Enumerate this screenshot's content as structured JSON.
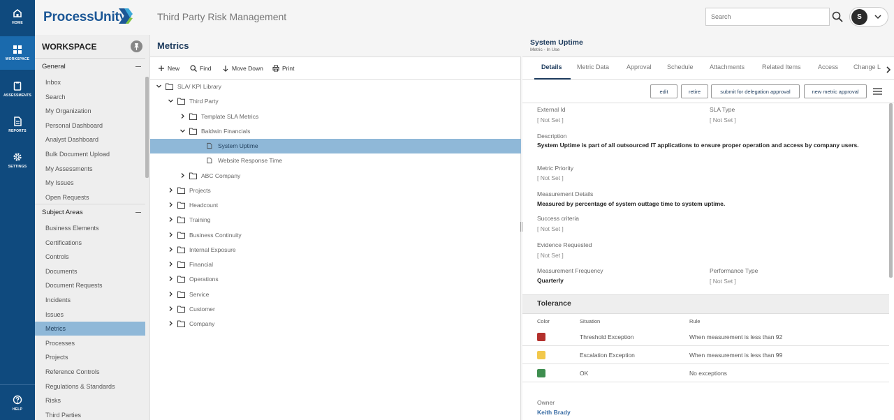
{
  "rail": {
    "home": "HOME",
    "workspace": "WORKSPACE",
    "assessments": "ASSESSMENTS",
    "reports": "REPORTS",
    "settings": "SETTINGS",
    "help": "HELP"
  },
  "header": {
    "logo": "ProcessUnity",
    "app_title": "Third Party Risk Management",
    "search_placeholder": "Search",
    "avatar_initial": "S"
  },
  "workspace": {
    "title": "WORKSPACE",
    "general_label": "General",
    "general_items": [
      "Inbox",
      "Search",
      "My Organization",
      "Personal Dashboard",
      "Analyst Dashboard",
      "Bulk Document Upload",
      "My Assessments",
      "My Issues",
      "Open Requests"
    ],
    "subject_label": "Subject Areas",
    "subject_items": [
      "Business Elements",
      "Certifications",
      "Controls",
      "Documents",
      "Document Requests",
      "Incidents",
      "Issues",
      "Metrics",
      "Processes",
      "Projects",
      "Reference Controls",
      "Regulations & Standards",
      "Risks",
      "Third Parties"
    ],
    "active_item": "Metrics"
  },
  "center": {
    "title": "Metrics",
    "toolbar": {
      "new": "New",
      "find": "Find",
      "move_down": "Move Down",
      "print": "Print"
    },
    "tree": [
      {
        "label": "SLA/ KPI Library",
        "depth": 0,
        "type": "folder",
        "expanded": true
      },
      {
        "label": "Third Party",
        "depth": 1,
        "type": "folder",
        "expanded": true
      },
      {
        "label": "Template SLA Metrics",
        "depth": 2,
        "type": "folder",
        "expanded": false
      },
      {
        "label": "Baldwin Financials",
        "depth": 2,
        "type": "folder",
        "expanded": true
      },
      {
        "label": "System Uptime",
        "depth": 3,
        "type": "file",
        "selected": true
      },
      {
        "label": "Website Response Time",
        "depth": 3,
        "type": "file"
      },
      {
        "label": "ABC Company",
        "depth": 2,
        "type": "folder",
        "expanded": false
      },
      {
        "label": "Projects",
        "depth": 1,
        "type": "folder",
        "expanded": false
      },
      {
        "label": "Headcount",
        "depth": 1,
        "type": "folder",
        "expanded": false
      },
      {
        "label": "Training",
        "depth": 1,
        "type": "folder",
        "expanded": false
      },
      {
        "label": "Business Continuity",
        "depth": 1,
        "type": "folder",
        "expanded": false
      },
      {
        "label": "Internal Exposure",
        "depth": 1,
        "type": "folder",
        "expanded": false
      },
      {
        "label": "Financial",
        "depth": 1,
        "type": "folder",
        "expanded": false
      },
      {
        "label": "Operations",
        "depth": 1,
        "type": "folder",
        "expanded": false
      },
      {
        "label": "Service",
        "depth": 1,
        "type": "folder",
        "expanded": false
      },
      {
        "label": "Customer",
        "depth": 1,
        "type": "folder",
        "expanded": false
      },
      {
        "label": "Company",
        "depth": 1,
        "type": "folder",
        "expanded": false
      }
    ]
  },
  "detail": {
    "title": "System Uptime",
    "subtitle": "Metric - In Use",
    "tabs": [
      "Details",
      "Metric Data",
      "Approval",
      "Schedule",
      "Attachments",
      "Related Items",
      "Access",
      "Change L"
    ],
    "active_tab": "Details",
    "actions": {
      "edit": "edit",
      "retire": "retire",
      "delegation": "submit for delegation approval",
      "new_approval": "new metric approval"
    },
    "fields": {
      "external_id_label": "External Id",
      "external_id_value": "[ Not Set ]",
      "sla_type_label": "SLA Type",
      "sla_type_value": "[ Not Set ]",
      "description_label": "Description",
      "description_value": "System Uptime is part of all outsourced IT applications to ensure proper operation and access by company users.",
      "priority_label": "Metric Priority",
      "priority_value": "[ Not Set ]",
      "measurement_label": "Measurement Details",
      "measurement_value": "Measured by percentage of system outtage time to system uptime.",
      "success_label": "Success criteria",
      "success_value": "[ Not Set ]",
      "evidence_label": "Evidence Requested",
      "evidence_value": "[ Not Set ]",
      "frequency_label": "Measurement Frequency",
      "frequency_value": "Quarterly",
      "performance_label": "Performance Type",
      "performance_value": "[ Not Set ]"
    },
    "tolerance": {
      "title": "Tolerance",
      "headers": {
        "color": "Color",
        "situation": "Situation",
        "rule": "Rule"
      },
      "rows": [
        {
          "color": "#b3302c",
          "situation": "Threshold Exception",
          "rule": "When measurement is less than 92"
        },
        {
          "color": "#f2c84b",
          "situation": "Escalation Exception",
          "rule": "When measurement is less than 99"
        },
        {
          "color": "#3e8e4f",
          "situation": "OK",
          "rule": "No exceptions"
        }
      ]
    },
    "owner_label": "Owner",
    "owner_value": "Keith Brady"
  }
}
